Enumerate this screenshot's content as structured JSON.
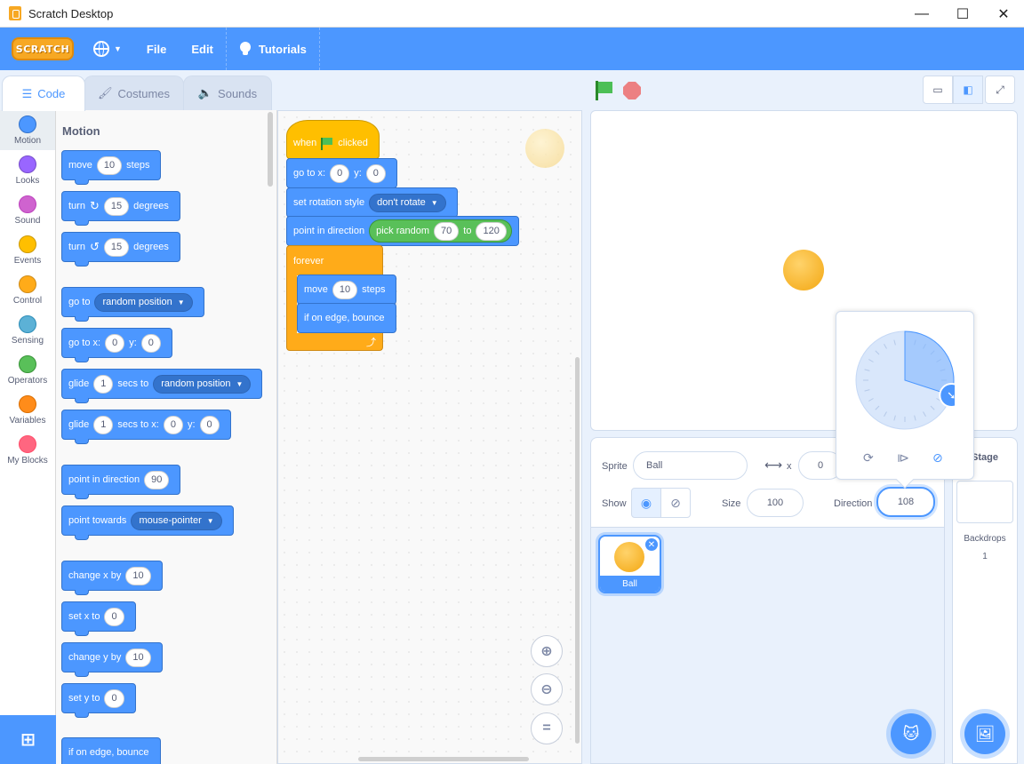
{
  "window": {
    "title": "Scratch Desktop",
    "minimize": "—",
    "maximize": "☐",
    "close": "✕"
  },
  "menubar": {
    "logo": "SCRATCH",
    "file": "File",
    "edit": "Edit",
    "tutorials": "Tutorials"
  },
  "tabs": {
    "code": "Code",
    "costumes": "Costumes",
    "sounds": "Sounds"
  },
  "categories": [
    {
      "label": "Motion",
      "color": "#4c97ff"
    },
    {
      "label": "Looks",
      "color": "#9966ff"
    },
    {
      "label": "Sound",
      "color": "#cf63cf"
    },
    {
      "label": "Events",
      "color": "#ffbf00"
    },
    {
      "label": "Control",
      "color": "#ffab19"
    },
    {
      "label": "Sensing",
      "color": "#5cb1d6"
    },
    {
      "label": "Operators",
      "color": "#59c059"
    },
    {
      "label": "Variables",
      "color": "#ff8c1a"
    },
    {
      "label": "My Blocks",
      "color": "#ff6680"
    }
  ],
  "palette": {
    "heading": "Motion",
    "move": {
      "a": "move",
      "n": "10",
      "b": "steps"
    },
    "turn_cw": {
      "a": "turn",
      "n": "15",
      "b": "degrees"
    },
    "turn_ccw": {
      "a": "turn",
      "n": "15",
      "b": "degrees"
    },
    "goto": {
      "a": "go to",
      "d": "random position"
    },
    "goto_xy": {
      "a": "go to x:",
      "x": "0",
      "b": "y:",
      "y": "0"
    },
    "glide": {
      "a": "glide",
      "n": "1",
      "b": "secs to",
      "d": "random position"
    },
    "glide_xy": {
      "a": "glide",
      "n": "1",
      "b": "secs to x:",
      "x": "0",
      "c": "y:",
      "y": "0"
    },
    "point_dir": {
      "a": "point in direction",
      "n": "90"
    },
    "point_towards": {
      "a": "point towards",
      "d": "mouse-pointer"
    },
    "change_x": {
      "a": "change x by",
      "n": "10"
    },
    "set_x": {
      "a": "set x to",
      "n": "0"
    },
    "change_y": {
      "a": "change y by",
      "n": "10"
    },
    "set_y": {
      "a": "set y to",
      "n": "0"
    },
    "edge": {
      "a": "if on edge, bounce"
    }
  },
  "script": {
    "hat": {
      "a": "when",
      "b": "clicked"
    },
    "goto_xy": {
      "a": "go to x:",
      "x": "0",
      "b": "y:",
      "y": "0"
    },
    "rotation": {
      "a": "set rotation style",
      "d": "don't rotate"
    },
    "point": {
      "a": "point in direction",
      "r": "pick random",
      "from": "70",
      "to_label": "to",
      "to": "120"
    },
    "forever": {
      "a": "forever"
    },
    "move": {
      "a": "move",
      "n": "10",
      "b": "steps"
    },
    "edge": {
      "a": "if on edge, bounce"
    }
  },
  "sprite_info": {
    "sprite_label": "Sprite",
    "sprite_name": "Ball",
    "x_label": "x",
    "x_value": "0",
    "show_label": "Show",
    "size_label": "Size",
    "size_value": "100",
    "direction_label": "Direction",
    "direction_value": "108"
  },
  "sprites": [
    {
      "name": "Ball"
    }
  ],
  "stage_pane": {
    "title": "Stage",
    "backdrops_label": "Backdrops",
    "backdrops_count": "1"
  },
  "direction_popover": {
    "direction": 108
  },
  "colors": {
    "accent": "#4c97ff",
    "motion": "#4c97ff",
    "events": "#ffbf00",
    "control": "#ffab19",
    "operators": "#59c059"
  }
}
